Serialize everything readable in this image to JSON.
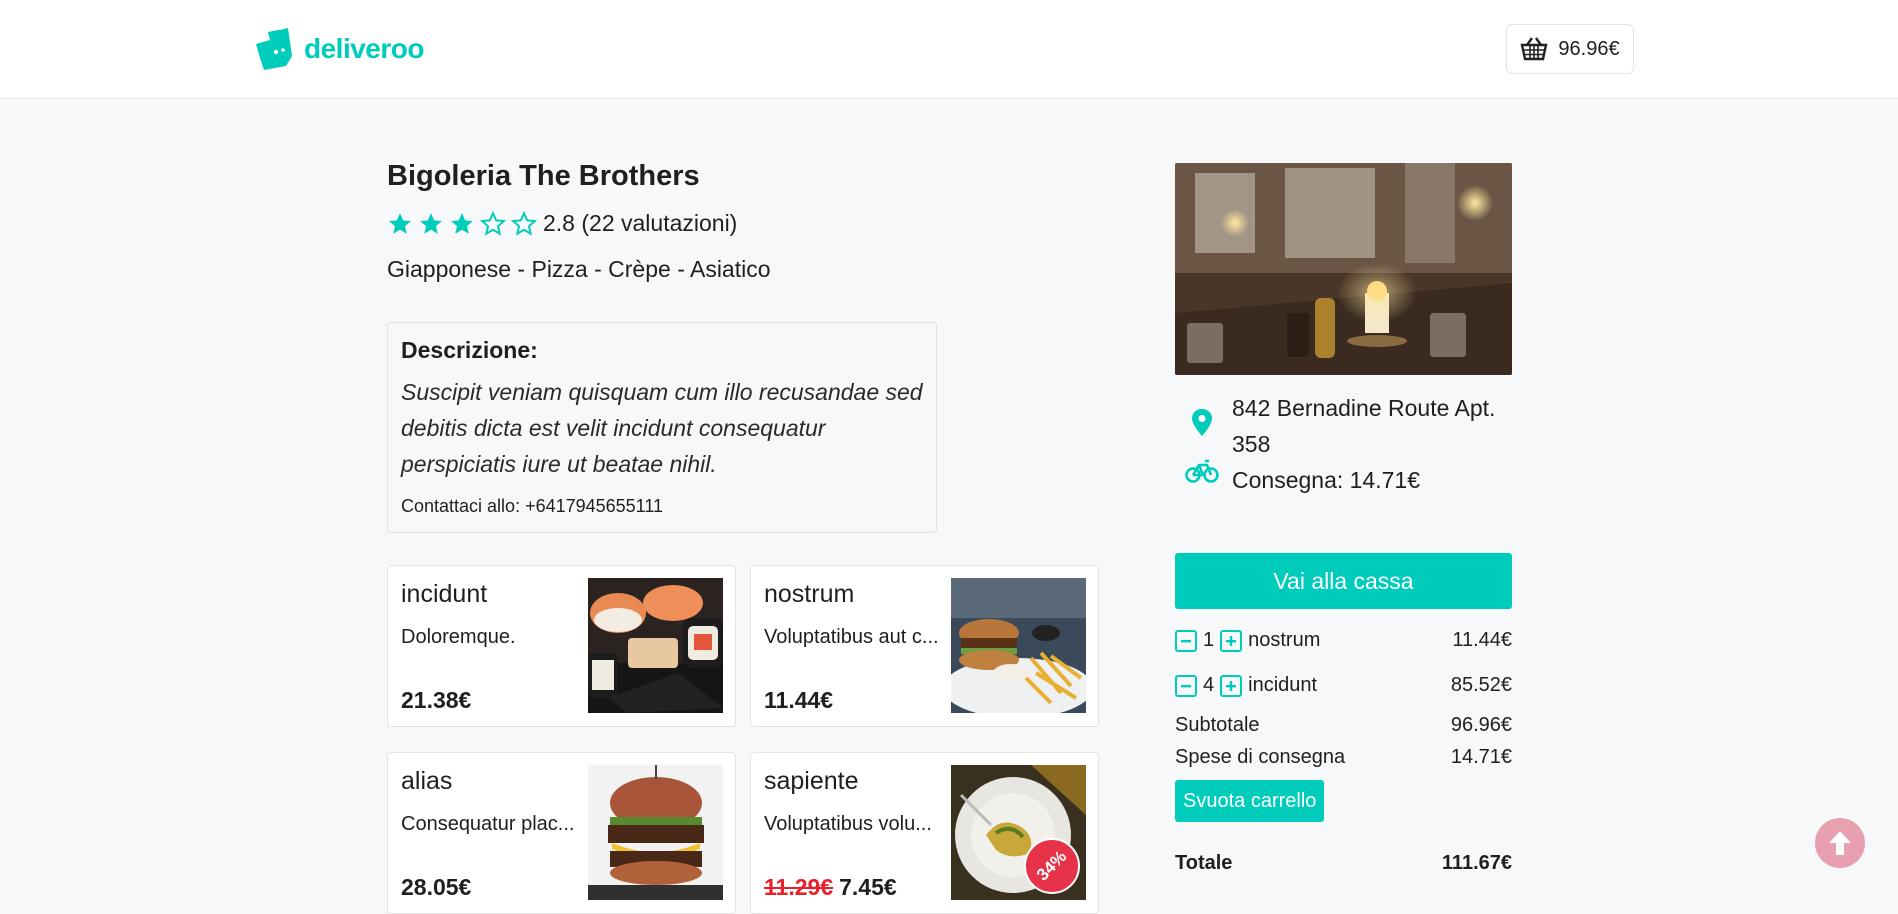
{
  "brand": {
    "name": "deliveroo",
    "color": "#00ccbc"
  },
  "header": {
    "cart_total": "96.96€"
  },
  "restaurant": {
    "name": "Bigoleria The Brothers",
    "rating_text": "2.8 (22 valutazioni)",
    "stars_filled": 3,
    "stars_total": 5,
    "cuisines": "Giapponese - Pizza - Crèpe - Asiatico",
    "description_title": "Descrizione:",
    "description": "Suscipit veniam quisquam cum illo recusandae sed debitis dicta est velit incidunt consequatur perspiciatis iure ut beatae nihil.",
    "contact": "Contattaci allo: +6417945655111",
    "address": "842 Bernadine Route Apt. 358",
    "delivery": "Consegna: 14.71€"
  },
  "menu": [
    {
      "name": "incidunt",
      "desc": "Doloremque.",
      "price": "21.38€",
      "old_price": "",
      "badge": ""
    },
    {
      "name": "nostrum",
      "desc": "Voluptatibus aut c...",
      "price": "11.44€",
      "old_price": "",
      "badge": ""
    },
    {
      "name": "alias",
      "desc": "Consequatur plac...",
      "price": "28.05€",
      "old_price": "",
      "badge": ""
    },
    {
      "name": "sapiente",
      "desc": "Voluptatibus volu...",
      "price": "7.45€",
      "old_price": "11.29€",
      "badge": "34%"
    }
  ],
  "cart": {
    "checkout_label": "Vai alla cassa",
    "items": [
      {
        "qty": "1",
        "name": "nostrum",
        "price": "11.44€"
      },
      {
        "qty": "4",
        "name": "incidunt",
        "price": "85.52€"
      }
    ],
    "subtotal_label": "Subtotale",
    "subtotal": "96.96€",
    "shipping_label": "Spese di consegna",
    "shipping": "14.71€",
    "empty_label": "Svuota carrello",
    "total_label": "Totale",
    "total": "111.67€"
  }
}
